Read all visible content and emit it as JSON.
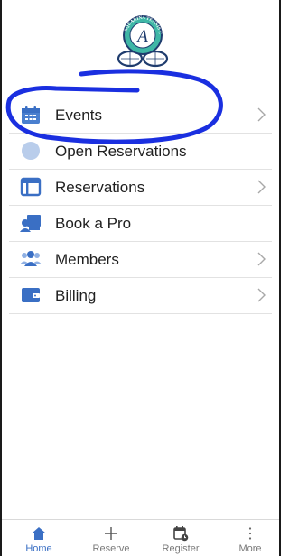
{
  "club": {
    "logo_text": "AQUARINA TENNIS CLUB",
    "logo_letter": "A"
  },
  "menu": {
    "items": [
      {
        "label": "Events",
        "icon": "calendar-icon",
        "chevron": true
      },
      {
        "label": "Open Reservations",
        "icon": "circle-icon",
        "chevron": false
      },
      {
        "label": "Reservations",
        "icon": "window-icon",
        "chevron": true
      },
      {
        "label": "Book a Pro",
        "icon": "instructor-icon",
        "chevron": false
      },
      {
        "label": "Members",
        "icon": "people-icon",
        "chevron": true
      },
      {
        "label": "Billing",
        "icon": "wallet-icon",
        "chevron": true
      }
    ]
  },
  "tabbar": {
    "tabs": [
      {
        "label": "Home",
        "icon": "home-icon",
        "active": true
      },
      {
        "label": "Reserve",
        "icon": "plus-icon",
        "active": false
      },
      {
        "label": "Register",
        "icon": "calendar-clock-icon",
        "active": false
      },
      {
        "label": "More",
        "icon": "more-vertical-icon",
        "active": false
      }
    ]
  },
  "colors": {
    "accent": "#3a6fc4",
    "icon_blue": "#4a7fcf",
    "logo_teal": "#3fb7a6",
    "logo_navy": "#1f3c6e",
    "annotation_ink": "#1a2fe0"
  }
}
